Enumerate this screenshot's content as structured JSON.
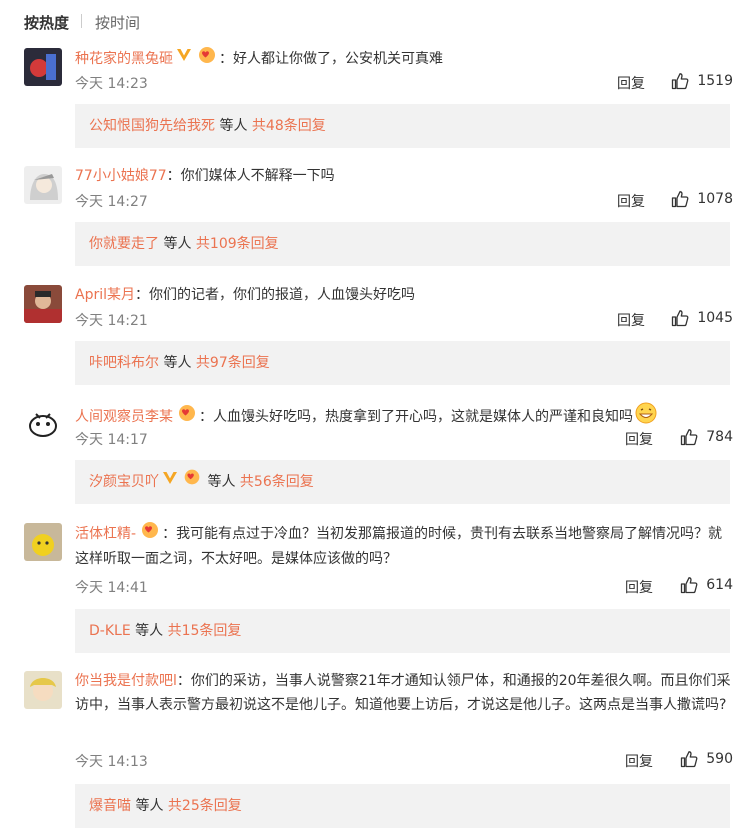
{
  "sort": {
    "hot": "按热度",
    "time": "按时间"
  },
  "reply_label": "回复",
  "colors": {
    "name": "#eb7350",
    "bg_sub": "#f2f2f2",
    "text": "#333333",
    "meta": "#808080"
  },
  "comments": [
    {
      "user": "种花家的黑兔砸",
      "badges": [
        "vip-v-icon",
        "heart-hands-icon"
      ],
      "text": "好人都让你做了，公安机关可真难",
      "time": "今天 14:23",
      "likes": "1519",
      "sub": {
        "user": "公知恨国狗先给我死",
        "mid": " 等人 ",
        "count": "共48条回复"
      }
    },
    {
      "user": "77小小姑娘77",
      "badges": [],
      "text": "你们媒体人不解释一下吗",
      "time": "今天 14:27",
      "likes": "1078",
      "sub": {
        "user": "你就要走了",
        "mid": " 等人 ",
        "count": "共109条回复"
      }
    },
    {
      "user": "April某月",
      "badges": [],
      "text": "你们的记者，你们的报道，人血馒头好吃吗",
      "time": "今天 14:21",
      "likes": "1045",
      "sub": {
        "user": "咔吧科布尔",
        "mid": " 等人 ",
        "count": "共97条回复"
      }
    },
    {
      "user": "人间观察员李某",
      "badges": [
        "heart-hands-icon"
      ],
      "text": "人血馒头好吃吗，热度拿到了开心吗，这就是媒体人的严谨和良知吗",
      "time": "今天 14:17",
      "likes": "784",
      "sub": {
        "user": "汐颜宝贝吖",
        "mid": " 等人 ",
        "count": "共56条回复",
        "badges": [
          "vip-v-icon",
          "heart-hands-icon"
        ]
      }
    },
    {
      "user": "活体杠精-",
      "badges": [
        "heart-hands-icon"
      ],
      "text": "我可能有点过于冷血？当初发那篇报道的时候，贵刊有去联系当地警察局了解情况吗？就这样听取一面之词，不太好吧。是媒体应该做的吗？",
      "time": "今天 14:41",
      "likes": "614",
      "sub": {
        "user": "D-KLE",
        "mid": " 等人 ",
        "count": "共15条回复"
      }
    },
    {
      "user": "你当我是付款吧l",
      "badges": [],
      "text": "你们的采访，当事人说警察21年才通知认领尸体，和通报的20年差很久啊。而且你们采访中，当事人表示警方最初说这不是他儿子。知道他要上访后，才说这是他儿子。这两点是当事人撒谎吗?",
      "time": "今天 14:13",
      "likes": "590",
      "sub": {
        "user": "爆音喵",
        "mid": " 等人 ",
        "count": "共25条回复"
      }
    }
  ]
}
